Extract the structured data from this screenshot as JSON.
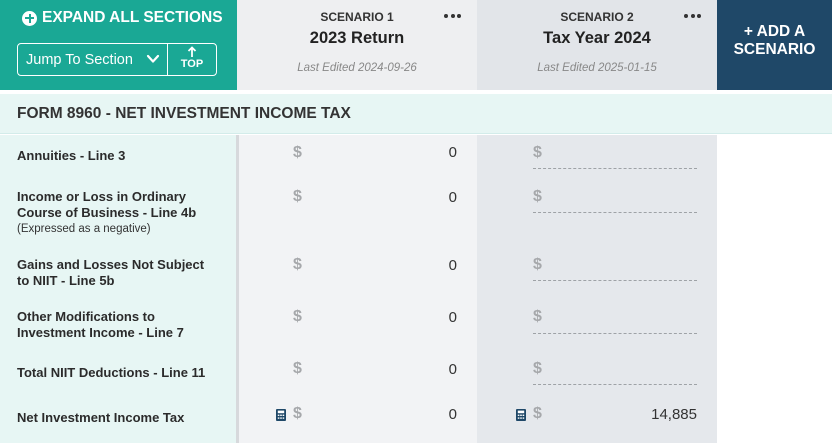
{
  "header": {
    "expand_label": "EXPAND ALL SECTIONS",
    "jump_label": "Jump To Section",
    "top_label": "TOP",
    "add_scenario_line1": "+ ADD A",
    "add_scenario_line2": "SCENARIO"
  },
  "scenarios": [
    {
      "label": "SCENARIO 1",
      "name": "2023 Return",
      "edited": "Last Edited 2024-09-26"
    },
    {
      "label": "SCENARIO 2",
      "name": "Tax Year 2024",
      "edited": "Last Edited 2025-01-15"
    }
  ],
  "section": {
    "title": "FORM 8960 - NET INVESTMENT INCOME TAX"
  },
  "currency_symbol": "$",
  "rows": [
    {
      "label_1": "Annuities - Line 3",
      "s1": "0",
      "s2": ""
    },
    {
      "label_1": "Income or Loss in Ordinary",
      "label_2": "Course of Business - Line 4b",
      "note": "(Expressed as a negative)",
      "s1": "0",
      "s2": ""
    },
    {
      "label_1": "Gains and Losses Not Subject",
      "label_2": "to NIIT - Line 5b",
      "s1": "0",
      "s2": ""
    },
    {
      "label_1": "Other Modifications to",
      "label_2": "Investment Income - Line 7",
      "s1": "0",
      "s2": ""
    },
    {
      "label_1": "Total NIIT Deductions - Line 11",
      "s1": "0",
      "s2": ""
    },
    {
      "label_1": "Net Investment Income Tax",
      "s1": "0",
      "s2": "14,885"
    }
  ],
  "icons": {
    "expand": "plus-circle-icon",
    "jump": "chevron-down-icon",
    "top": "arrow-up-icon",
    "menu": "more-horizontal-icon",
    "calc": "calculator-icon"
  },
  "colors": {
    "teal": "#1aa895",
    "navy": "#1f4868",
    "section_bg": "#e7f6f4",
    "calc_icon": "#1f4868"
  }
}
